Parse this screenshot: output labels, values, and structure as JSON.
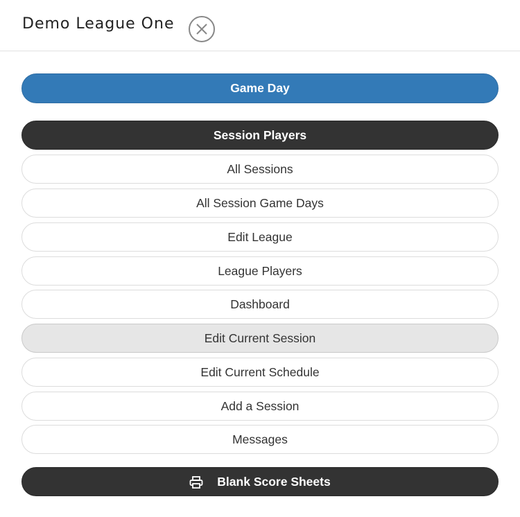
{
  "header": {
    "title": "Demo League One",
    "close_icon": "close-circle-icon"
  },
  "menu": {
    "game_day": "Game Day",
    "session_players": "Session Players",
    "items": [
      "All Sessions",
      "All Session Game Days",
      "Edit League",
      "League Players",
      "Dashboard",
      "Edit Current Session",
      "Edit Current Schedule",
      "Add a Session",
      "Messages"
    ],
    "active_item": "Edit Current Session",
    "score_sheets": "Blank Score Sheets",
    "score_sheets_icon": "printer-icon"
  },
  "colors": {
    "primary": "#337ab7",
    "dark": "#333333",
    "active_bg": "#e6e6e6"
  }
}
